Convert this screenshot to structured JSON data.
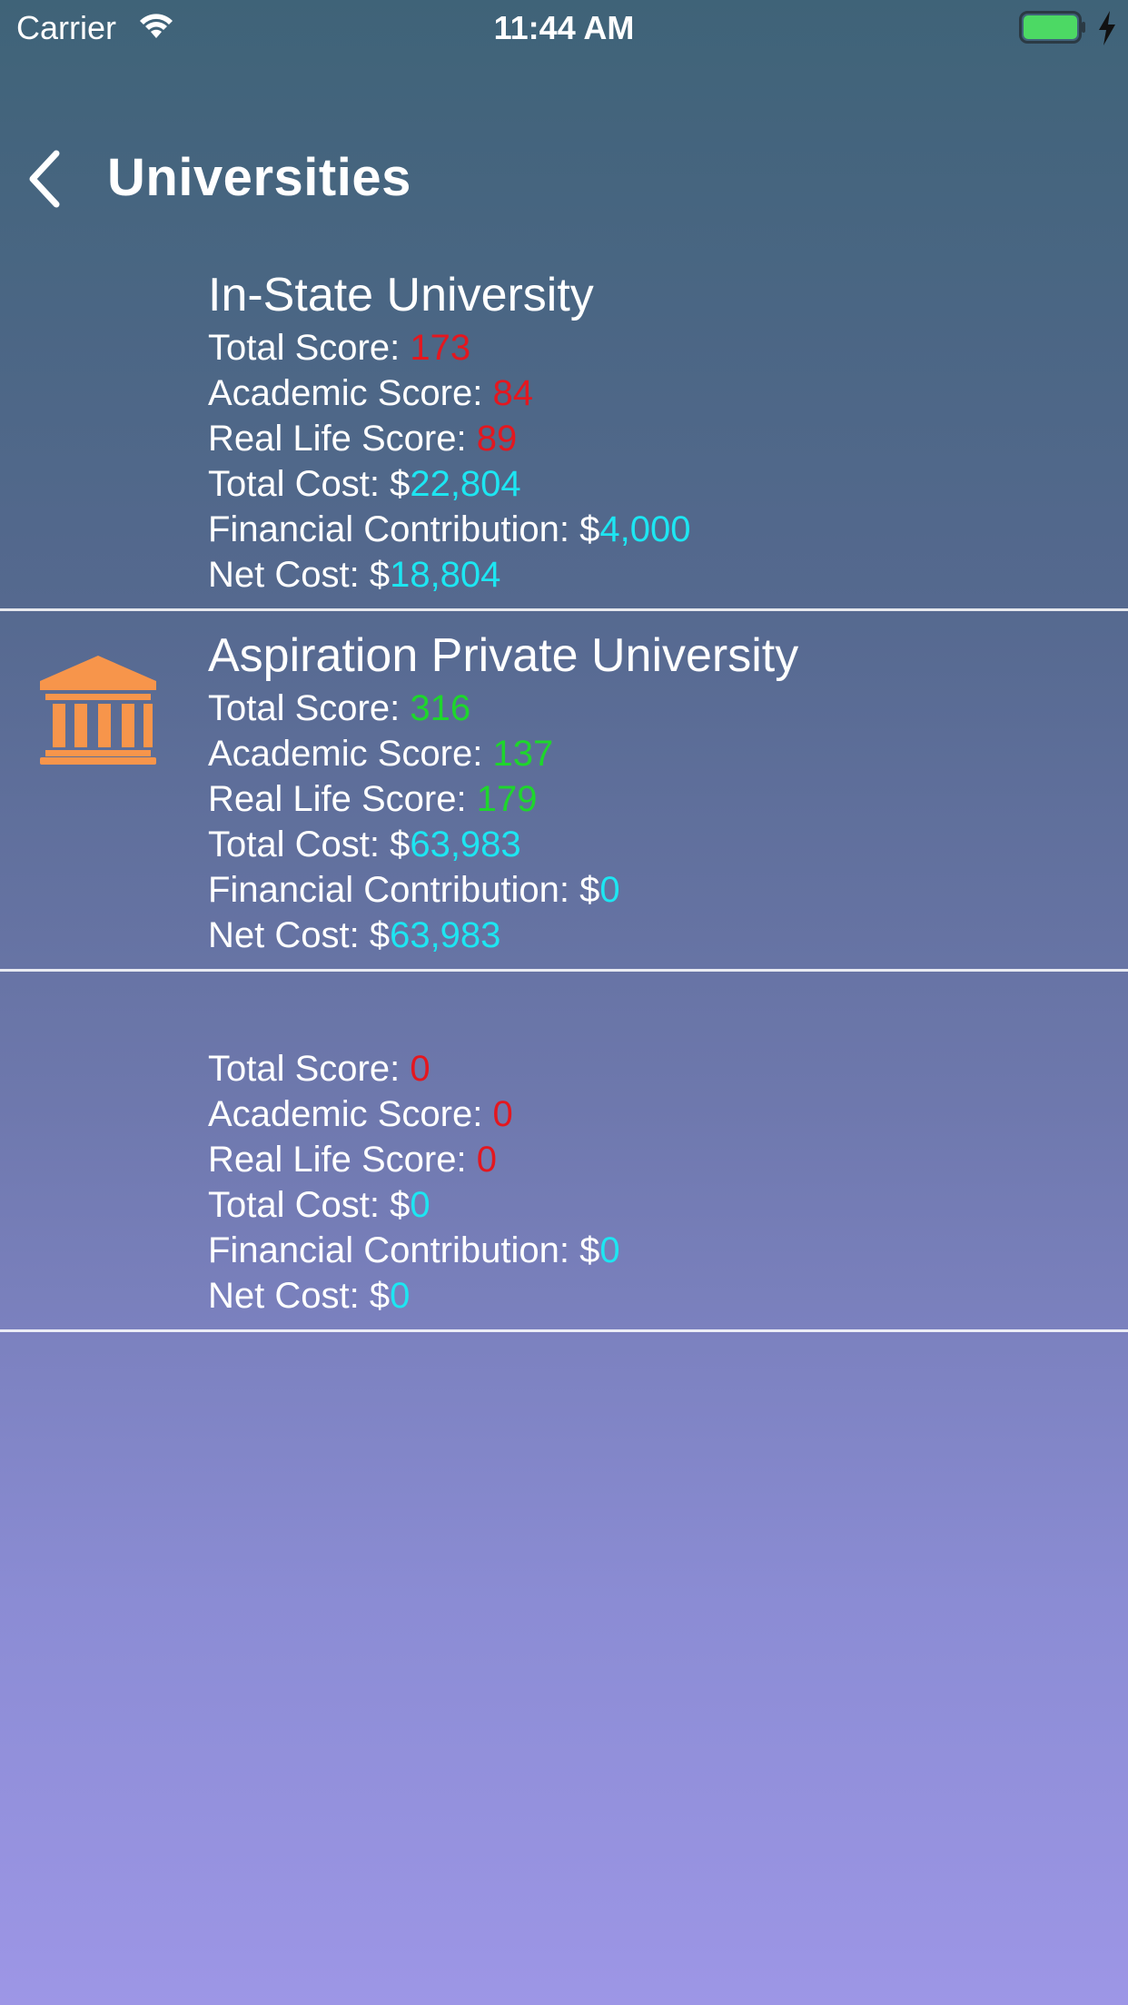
{
  "status_bar": {
    "carrier": "Carrier",
    "time": "11:44 AM",
    "wifi_icon": "wifi-icon",
    "battery_icon": "battery-icon",
    "battery_color": "#4cd964"
  },
  "nav": {
    "back_icon": "chevron-left-icon",
    "title": "Universities"
  },
  "universities": [
    {
      "name": "In-State University",
      "total_score_label": "Total Score: ",
      "total_score": "173",
      "academic_score_label": "Academic Score: ",
      "academic_score": "84",
      "real_life_score_label": "Real Life Score: ",
      "real_life_score": "89",
      "total_cost_label": "Total Cost: $",
      "total_cost": "22,804",
      "financial_contribution_label": "Financial Contribution: $",
      "financial_contribution": "4,000",
      "net_cost_label": "Net Cost: $",
      "net_cost": "18,804",
      "score_color": "#e4171f",
      "selected": false
    },
    {
      "name": "Aspiration Private University",
      "total_score_label": "Total Score: ",
      "total_score": "316",
      "academic_score_label": "Academic Score: ",
      "academic_score": "137",
      "real_life_score_label": "Real Life Score: ",
      "real_life_score": "179",
      "total_cost_label": "Total Cost: $",
      "total_cost": "63,983",
      "financial_contribution_label": "Financial Contribution: $",
      "financial_contribution": "0",
      "net_cost_label": "Net Cost: $",
      "net_cost": "63,983",
      "score_color": "#1ed62c",
      "selected": true,
      "icon": "university-building-icon",
      "icon_color": "#f7954b"
    },
    {
      "name": "",
      "total_score_label": "Total Score: ",
      "total_score": "0",
      "academic_score_label": "Academic Score: ",
      "academic_score": "0",
      "real_life_score_label": "Real Life Score: ",
      "real_life_score": "0",
      "total_cost_label": "Total Cost: $",
      "total_cost": "0",
      "financial_contribution_label": "Financial Contribution: $",
      "financial_contribution": "0",
      "net_cost_label": "Net Cost: $",
      "net_cost": "0",
      "score_color": "#e4171f",
      "selected": false
    }
  ],
  "value_color": "#1de6f2"
}
